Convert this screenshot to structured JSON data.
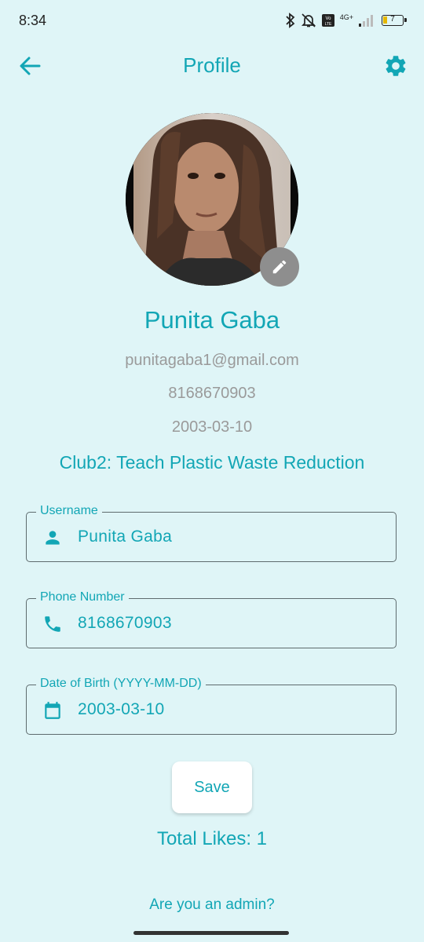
{
  "status_bar": {
    "time": "8:34",
    "network": "4G+",
    "battery": "7",
    "icons": [
      "bluetooth-icon",
      "bell-off-icon",
      "volte-icon",
      "signal-icon",
      "battery-icon"
    ]
  },
  "app_bar": {
    "title": "Profile",
    "back_icon": "arrow-left-icon",
    "settings_icon": "gear-icon"
  },
  "profile": {
    "name": "Punita Gaba",
    "email": "punitagaba1@gmail.com",
    "phone": "8168670903",
    "dob": "2003-03-10",
    "club": "Club2: Teach Plastic Waste Reduction",
    "edit_icon": "pencil-icon"
  },
  "form": {
    "username": {
      "label": "Username",
      "value": "Punita Gaba",
      "icon": "person-icon"
    },
    "phone": {
      "label": "Phone Number",
      "value": "8168670903",
      "icon": "phone-icon"
    },
    "dob": {
      "label": "Date of Birth (YYYY-MM-DD)",
      "value": "2003-03-10",
      "icon": "calendar-icon"
    }
  },
  "save_label": "Save",
  "total_likes": "Total Likes: 1",
  "admin_link": "Are you an admin?",
  "colors": {
    "accent": "#12a6b5",
    "background": "#dff5f7",
    "secondary_text": "#9a9a9a"
  }
}
